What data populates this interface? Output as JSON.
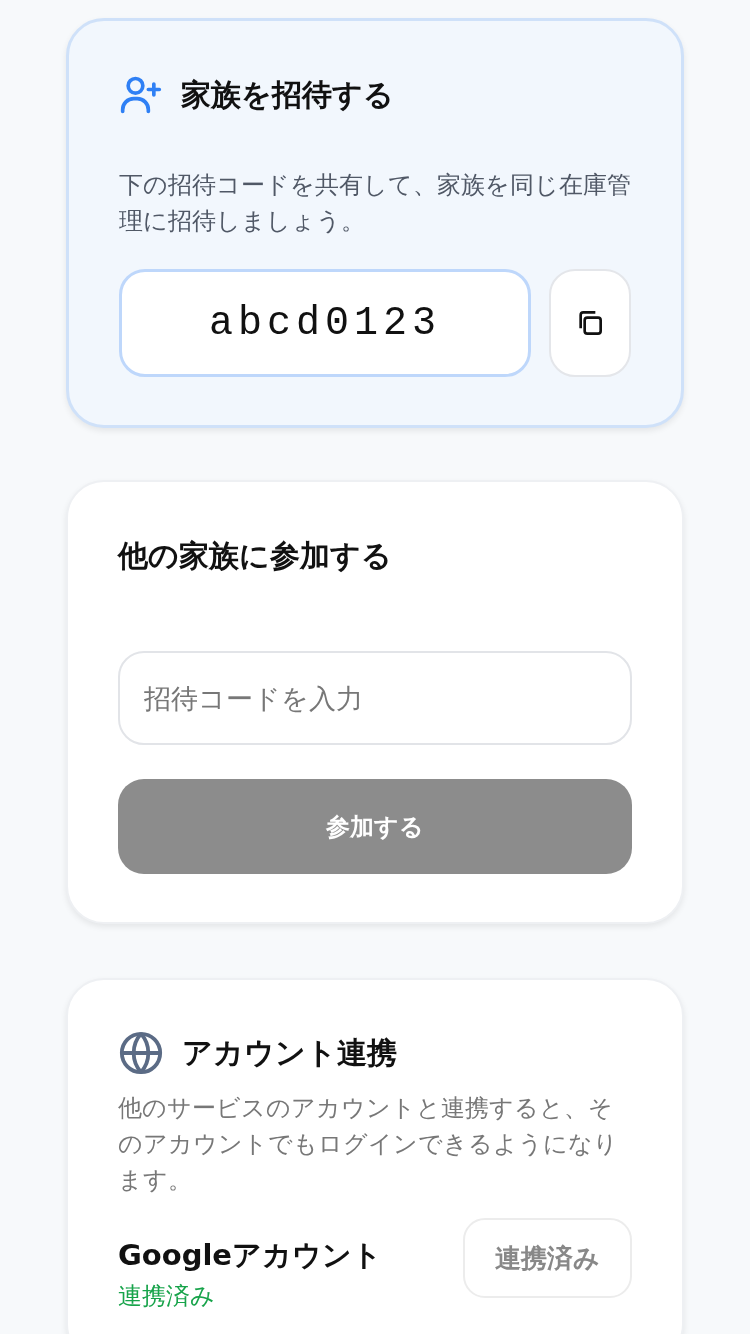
{
  "invite": {
    "title": "家族を招待する",
    "description": "下の招待コードを共有して、家族を同じ在庫管理に招待しましょう。",
    "code": "abcd0123"
  },
  "join": {
    "title": "他の家族に参加する",
    "placeholder": "招待コードを入力",
    "button": {
      "label": "参加する",
      "disabled": true
    }
  },
  "linking": {
    "title": "アカウント連携",
    "description": "他のサービスのアカウントと連携すると、そのアカウントでもログインできるようになります。",
    "accounts": [
      {
        "name": "Googleアカウント",
        "status": "連携済み",
        "linked": true,
        "button": "連携済み"
      }
    ]
  }
}
